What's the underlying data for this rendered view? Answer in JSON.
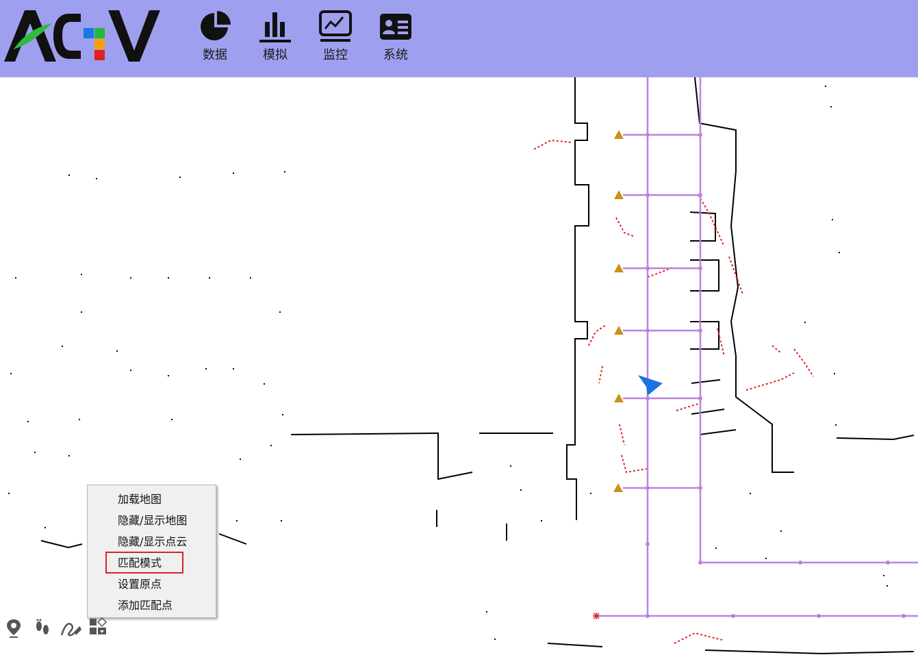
{
  "app": {
    "logo_text": "AGV"
  },
  "nav": [
    {
      "label": "数据",
      "icon": "pie-chart-icon"
    },
    {
      "label": "模拟",
      "icon": "bar-chart-icon"
    },
    {
      "label": "监控",
      "icon": "monitor-chart-icon"
    },
    {
      "label": "系统",
      "icon": "id-card-icon"
    }
  ],
  "context_menu": {
    "items": [
      "加载地图",
      "隐藏/显示地图",
      "隐藏/显示点云",
      "匹配模式",
      "设置原点",
      "添加匹配点"
    ],
    "highlighted_item": "匹配模式"
  },
  "toolbar": [
    {
      "icon": "map-pin-icon"
    },
    {
      "icon": "footprints-icon"
    },
    {
      "icon": "draw-path-icon"
    },
    {
      "icon": "layers-menu-icon"
    }
  ],
  "colors": {
    "header_bg": "#9f9ff0",
    "route": "#b884e0",
    "station": "#c8931a",
    "agv_marker": "#1e72e0",
    "point_cloud": "#e02020",
    "map_obstacle": "#000000",
    "highlight_border": "#e02020"
  }
}
